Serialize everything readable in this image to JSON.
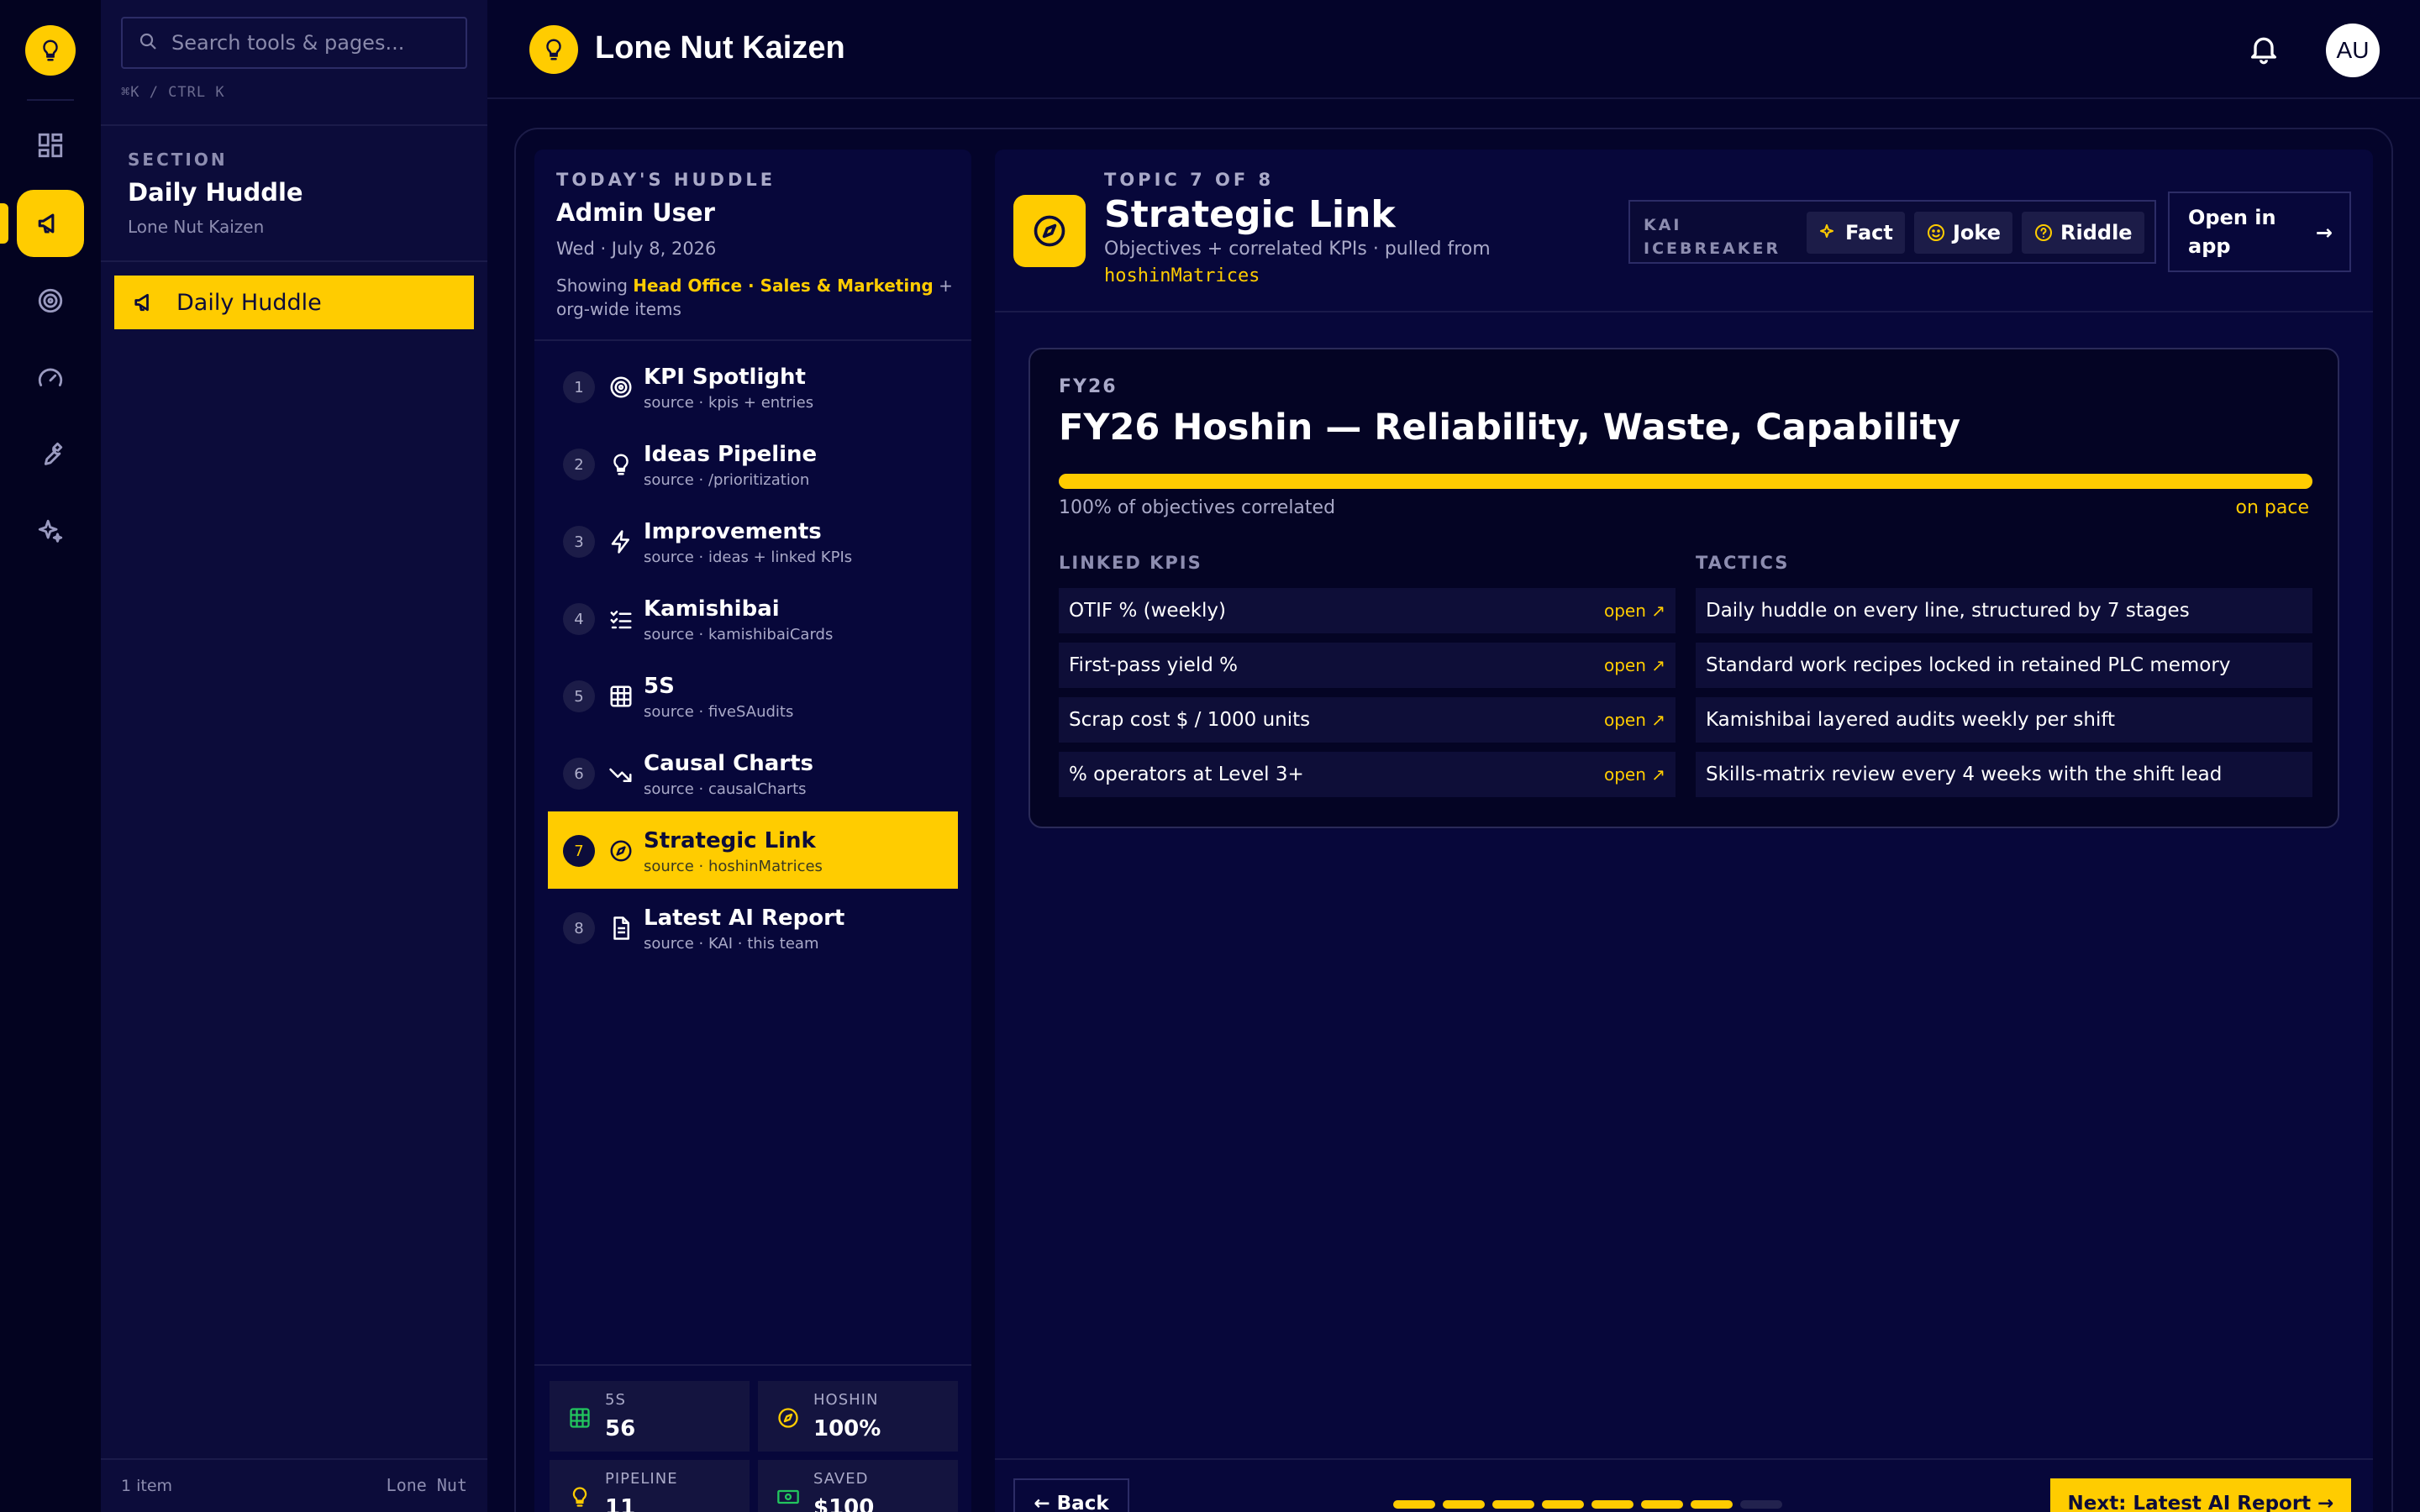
{
  "rail": {
    "icons": [
      "lightbulb-icon",
      "dashboard-icon",
      "megaphone-icon",
      "target-icon",
      "gauge-icon",
      "wrench-icon",
      "sparkles-icon"
    ],
    "accent": "#ffcc00"
  },
  "sidebar": {
    "search_placeholder": "Search tools & pages...",
    "shortcut": "⌘K / CTRL K",
    "section_label": "SECTION",
    "section_title": "Daily Huddle",
    "section_sub": "Lone Nut Kaizen",
    "items": [
      {
        "label": "Daily Huddle",
        "icon": "megaphone-icon",
        "active": true
      }
    ],
    "count": "1 item",
    "brand": "Lone Nut"
  },
  "topbar": {
    "title": "Lone Nut Kaizen",
    "avatar": "AU"
  },
  "agenda": {
    "label": "TODAY'S HUDDLE",
    "name": "Admin User",
    "date": "Wed · July 8, 2026",
    "showing_prefix": "Showing",
    "showing_scope": "Head Office · Sales & Marketing",
    "showing_suffix": "+ org-wide items",
    "items": [
      {
        "num": "1",
        "title": "KPI Spotlight",
        "source": "source · kpis + entries",
        "icon": "target-icon"
      },
      {
        "num": "2",
        "title": "Ideas Pipeline",
        "source": "source · /prioritization",
        "icon": "lightbulb-icon"
      },
      {
        "num": "3",
        "title": "Improvements",
        "source": "source · ideas + linked KPIs",
        "icon": "bolt-icon"
      },
      {
        "num": "4",
        "title": "Kamishibai",
        "source": "source · kamishibaiCards",
        "icon": "checklist-icon"
      },
      {
        "num": "5",
        "title": "5S",
        "source": "source · fiveSAudits",
        "icon": "grid-icon"
      },
      {
        "num": "6",
        "title": "Causal Charts",
        "source": "source · causalCharts",
        "icon": "trend-down-icon"
      },
      {
        "num": "7",
        "title": "Strategic Link",
        "source": "source · hoshinMatrices",
        "icon": "compass-icon",
        "active": true
      },
      {
        "num": "8",
        "title": "Latest AI Report",
        "source": "source · KAI · this team",
        "icon": "document-icon"
      }
    ],
    "stats": [
      {
        "label": "5S",
        "value": "56",
        "icon": "grid-icon",
        "color": "#22c55e"
      },
      {
        "label": "HOSHIN",
        "value": "100%",
        "icon": "compass-icon",
        "color": "#ffcc00"
      },
      {
        "label": "PIPELINE",
        "value": "11",
        "icon": "lightbulb-icon",
        "color": "#ffcc00"
      },
      {
        "label": "SAVED",
        "value": "$100",
        "icon": "cash-icon",
        "color": "#22c55e"
      }
    ]
  },
  "topic": {
    "count": "TOPIC 7 OF 8",
    "title": "Strategic Link",
    "subtitle": "Objectives + correlated KPIs · pulled from",
    "code": "hoshinMatrices",
    "kai_label_1": "KAI",
    "kai_label_2": "ICEBREAKER",
    "kai_buttons": [
      "Fact",
      "Joke",
      "Riddle"
    ],
    "open_app_1": "Open in",
    "open_app_2": "app"
  },
  "card": {
    "fy": "FY26",
    "title": "FY26 Hoshin — Reliability, Waste, Capability",
    "progress": 1.0,
    "caption": "100% of objectives correlated",
    "pace": "on pace",
    "kpis_head": "LINKED KPIS",
    "tactics_head": "TACTICS",
    "kpis": [
      {
        "name": "OTIF % (weekly)",
        "link": "open ↗"
      },
      {
        "name": "First-pass yield %",
        "link": "open ↗"
      },
      {
        "name": "Scrap cost $ / 1000 units",
        "link": "open ↗"
      },
      {
        "name": "% operators at Level 3+",
        "link": "open ↗"
      }
    ],
    "tactics": [
      "Daily huddle on every line, structured by 7 stages",
      "Standard work recipes locked in retained PLC memory",
      "Kamishibai layered audits weekly per shift",
      "Skills-matrix review every 4 weeks with the shift lead"
    ]
  },
  "footer": {
    "back": "← Back",
    "next": "Next: Latest AI Report →",
    "steps_total": 8,
    "current_step": 7
  }
}
